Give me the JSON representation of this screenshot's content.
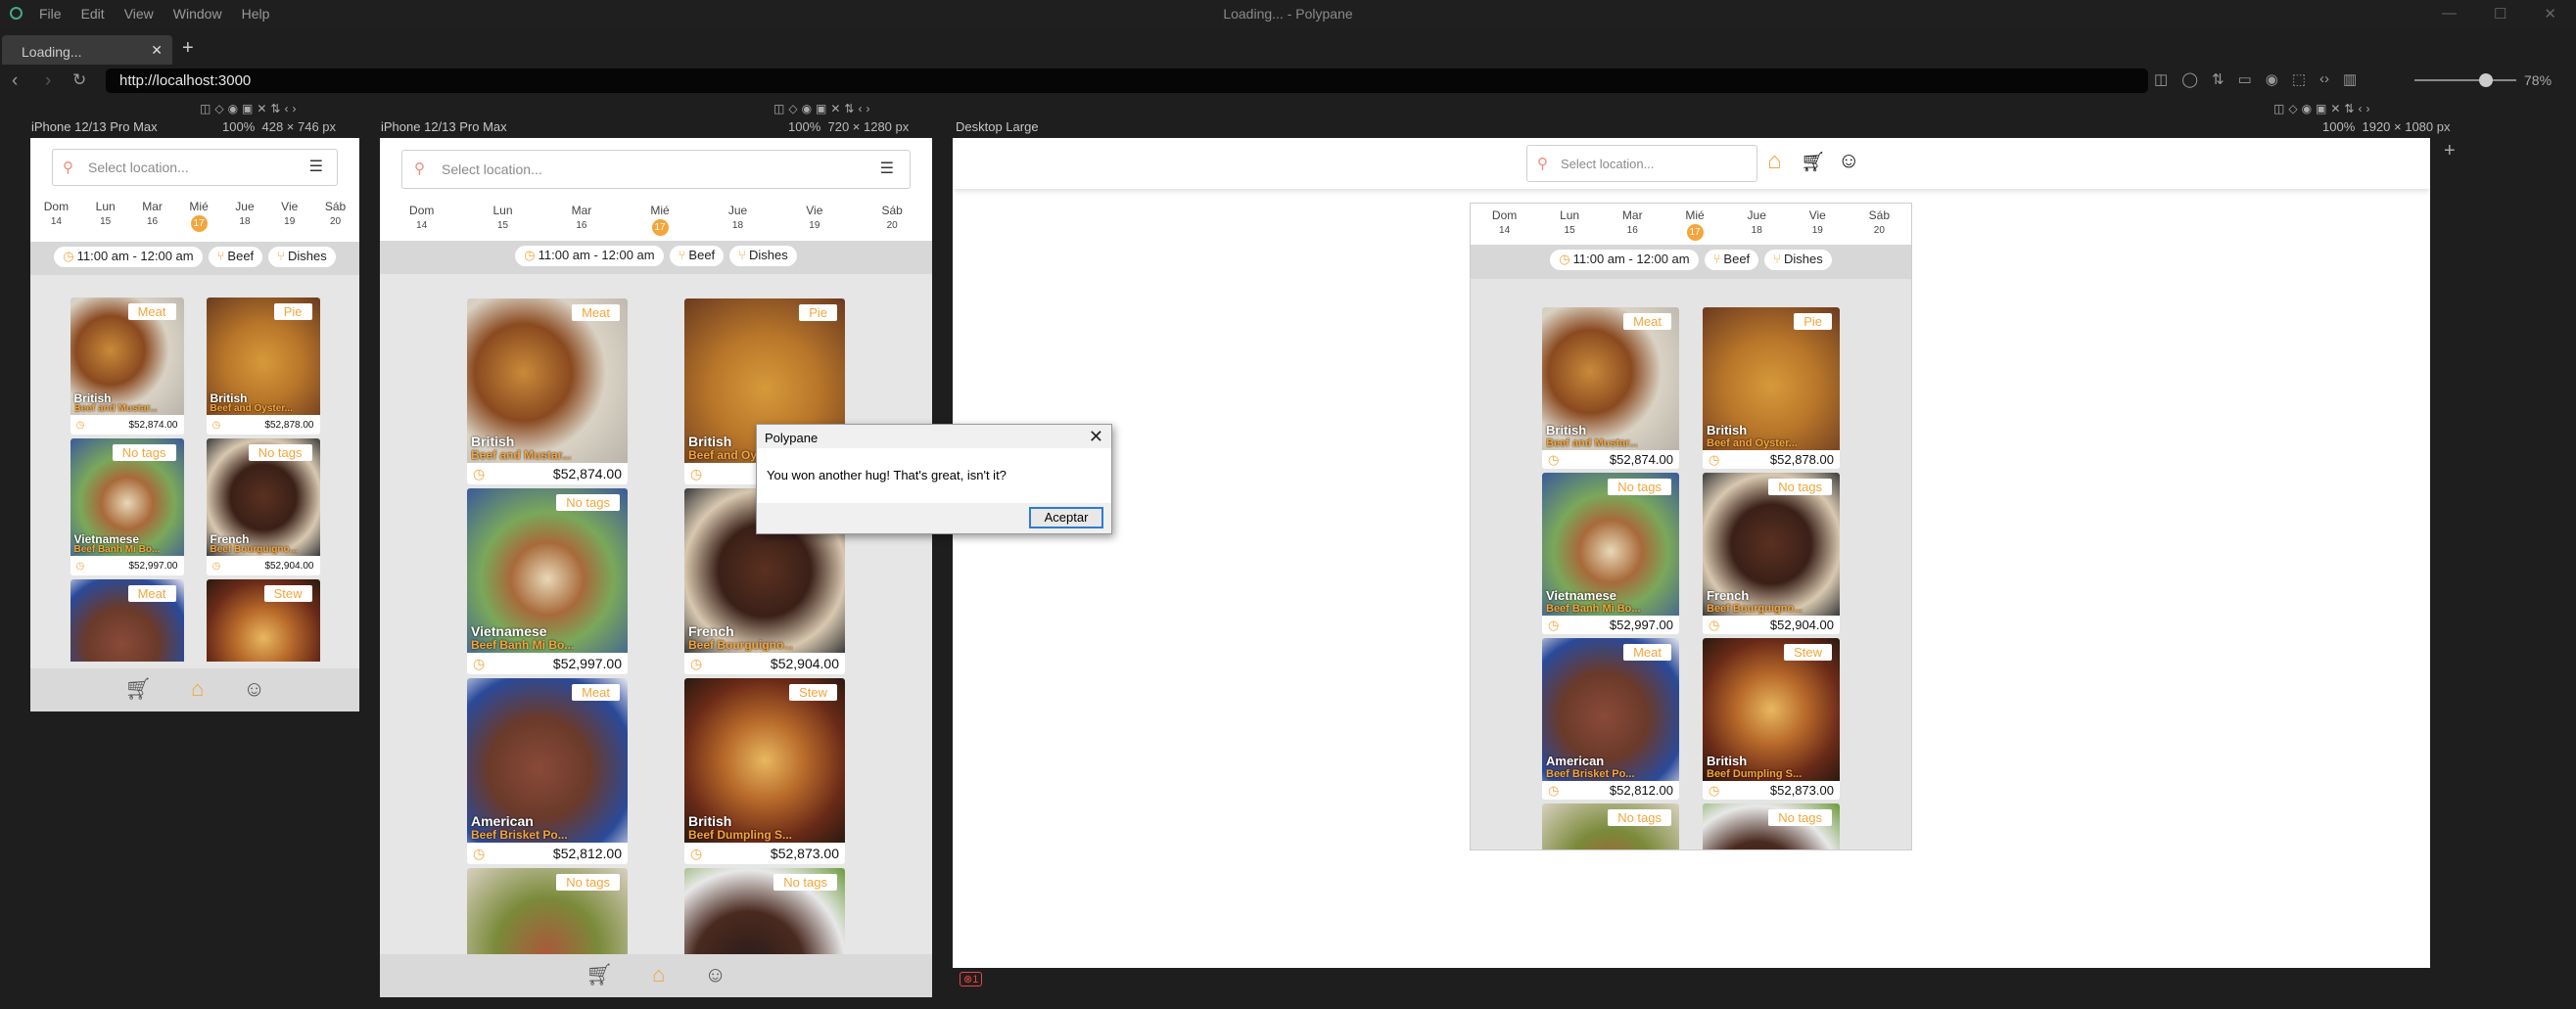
{
  "app": {
    "menu": [
      "File",
      "Edit",
      "View",
      "Window",
      "Help"
    ],
    "window_title": "Loading... - Polypane",
    "tab_title": "Loading...",
    "url": "http://localhost:3000",
    "zoom": "78%"
  },
  "panes": [
    {
      "label": "iPhone 12/13 Pro Max",
      "zoom": "100%",
      "size": "428 × 746 px"
    },
    {
      "label": "iPhone 12/13 Pro Max",
      "zoom": "100%",
      "size": "720 × 1280 px"
    },
    {
      "label": "Desktop Large",
      "zoom": "100%",
      "size": "1920 × 1080 px"
    }
  ],
  "search": {
    "placeholder": "Select location..."
  },
  "days": [
    {
      "name": "Dom",
      "num": "14"
    },
    {
      "name": "Lun",
      "num": "15"
    },
    {
      "name": "Mar",
      "num": "16"
    },
    {
      "name": "Mié",
      "num": "17",
      "selected": true
    },
    {
      "name": "Jue",
      "num": "18"
    },
    {
      "name": "Vie",
      "num": "19"
    },
    {
      "name": "Sáb",
      "num": "20"
    }
  ],
  "filters": {
    "time": "11:00 am - 12:00 am",
    "protein": "Beef",
    "category": "Dishes"
  },
  "cards": [
    {
      "tag": "Meat",
      "cuisine": "British",
      "name": "Beef and Mustar...",
      "price": "$52,874.00",
      "img": "pie"
    },
    {
      "tag": "Pie",
      "cuisine": "British",
      "name": "Beef and Oyster...",
      "price": "$52,878.00",
      "img": "oyster"
    },
    {
      "tag": "No tags",
      "cuisine": "Vietnamese",
      "name": "Beef Banh Mi Bo...",
      "price": "$52,997.00",
      "img": "banh"
    },
    {
      "tag": "No tags",
      "cuisine": "French",
      "name": "Beef Bourguigno...",
      "price": "$52,904.00",
      "img": "bourg"
    },
    {
      "tag": "Meat",
      "cuisine": "American",
      "name": "Beef Brisket Po...",
      "price": "$52,812.00",
      "img": "brisket"
    },
    {
      "tag": "Stew",
      "cuisine": "British",
      "name": "Beef Dumpling S...",
      "price": "$52,873.00",
      "img": "dumpling"
    },
    {
      "tag": "No tags",
      "cuisine": "",
      "name": "",
      "price": "",
      "img": "stirfry"
    },
    {
      "tag": "No tags",
      "cuisine": "",
      "name": "",
      "price": "",
      "img": "dark"
    }
  ],
  "dialog": {
    "title": "Polypane",
    "message": "You won another hug! That's great, isn't it?",
    "button": "Aceptar"
  },
  "status": {
    "errors": "1"
  },
  "colors": {
    "accent": "#f4a53b",
    "pin": "#f08a78"
  }
}
